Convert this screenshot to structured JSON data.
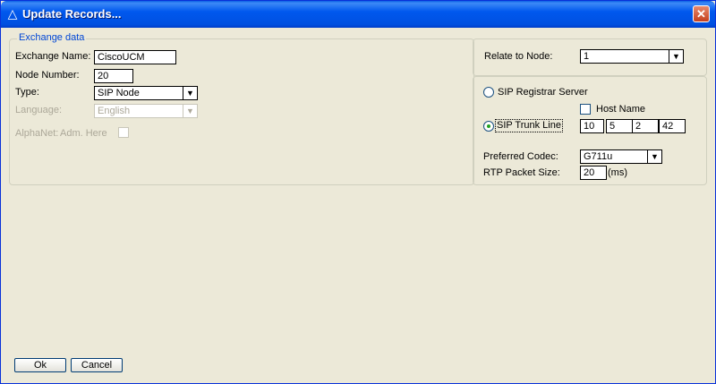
{
  "window": {
    "title": "Update Records...",
    "close_glyph": "✕",
    "title_icon": "triangle-icon"
  },
  "exchange": {
    "group_title": "Exchange data",
    "name_label": "Exchange Name:",
    "name_value": "CiscoUCM",
    "node_number_label": "Node Number:",
    "node_number_value": "20",
    "type_label": "Type:",
    "type_value": "SIP Node",
    "language_label": "Language:",
    "language_value": "English",
    "alphanet_label": "AlphaNet:",
    "adm_here_label": "Adm. Here"
  },
  "relate": {
    "label": "Relate to Node:",
    "value": "1"
  },
  "sip": {
    "registrar_label": "SIP Registrar Server",
    "host_name_label": "Host Name",
    "trunk_label": "SIP Trunk Line",
    "ip": [
      "10",
      "5",
      "2",
      "42"
    ],
    "codec_label": "Preferred Codec:",
    "codec_value": "G711u",
    "rtp_label": "RTP Packet Size:",
    "rtp_value": "20",
    "rtp_unit": "(ms)"
  },
  "buttons": {
    "ok": "Ok",
    "cancel": "Cancel"
  },
  "colors": {
    "title_bar": "#0058ee",
    "group_title": "#0046d5",
    "dialog_bg": "#ece9d8"
  }
}
